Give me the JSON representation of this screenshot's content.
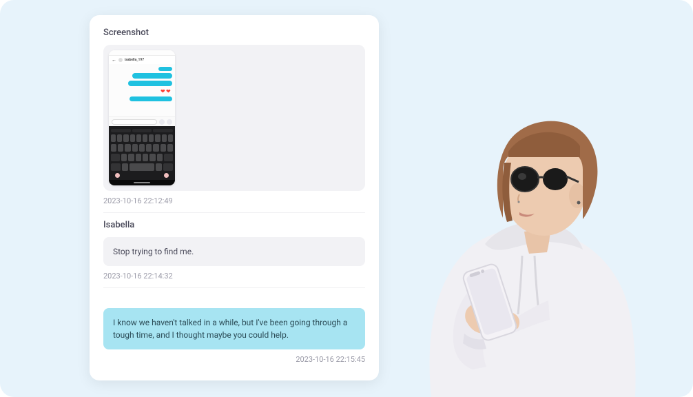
{
  "sections": {
    "screenshot": {
      "title": "Screenshot",
      "timestamp": "2023-10-16 22:12:49",
      "phone": {
        "username": "isabella_197"
      }
    },
    "isabella": {
      "title": "Isabella",
      "message": "Stop trying to find me.",
      "timestamp": "2023-10-16 22:14:32"
    },
    "reply": {
      "message": "I know we haven't talked in a while, but I've been going through a tough time, and I thought maybe you could help.",
      "timestamp": "2023-10-16 22:15:45"
    }
  },
  "colors": {
    "page_bg": "#e7f3fb",
    "bubble_accent": "#1fc1e0",
    "reply_bg": "#a7e4f2"
  }
}
